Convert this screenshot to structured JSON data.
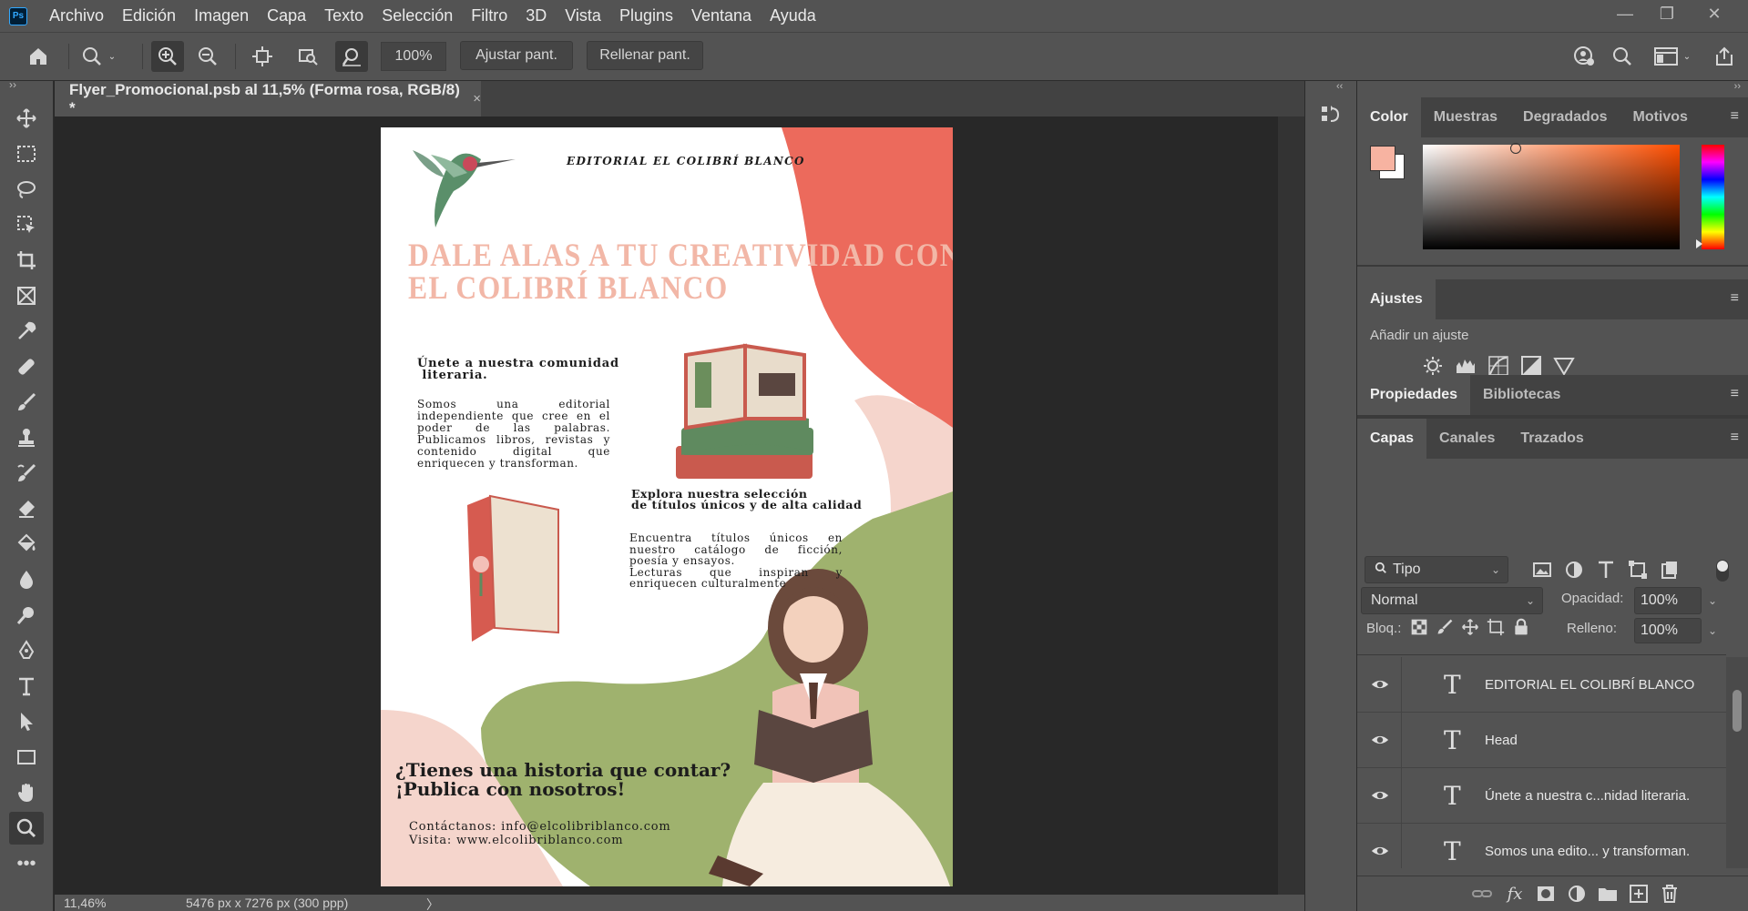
{
  "menubar": {
    "logo": "Ps",
    "items": [
      "Archivo",
      "Edición",
      "Imagen",
      "Capa",
      "Texto",
      "Selección",
      "Filtro",
      "3D",
      "Vista",
      "Plugins",
      "Ventana",
      "Ayuda"
    ]
  },
  "options": {
    "zoom_value": "100%",
    "fit_screen": "Ajustar pant.",
    "fill_screen": "Rellenar pant."
  },
  "document": {
    "tab_title": "Flyer_Promocional.psb al 11,5% (Forma rosa, RGB/8) *",
    "close": "×"
  },
  "status": {
    "zoom": "11,46%",
    "dims": "5476 px x 7276 px (300 ppp)",
    "arrow": "〉"
  },
  "flyer": {
    "publisher": "EDITORIAL EL COLIBRÍ  BLANCO",
    "headline": [
      "DALE ALAS A TU CREATIVIDAD CON",
      "EL COLIBRÍ BLANCO"
    ],
    "join_title": [
      "Únete a nuestra comunidad",
      " literaria."
    ],
    "about": [
      "Somos una editorial",
      "independiente que cree en el",
      "poder de las palabras.",
      "Publicamos libros, revistas y",
      "contenido digital que",
      "enriquecen y transforman."
    ],
    "explore_title": [
      "Explora nuestra selección",
      "de títulos únicos y de alta calidad"
    ],
    "explore_body": [
      "Encuentra títulos únicos en",
      "nuestro catálogo de ficción,",
      "poesía y ensayos.",
      "Lecturas que inspiran y",
      "enriquecen culturalmente"
    ],
    "cta": [
      "¿Tienes una historia que contar?",
      "¡Publica con nosotros!"
    ],
    "contact": "Contáctanos: info@elcolibriblanco.com",
    "visit": "Visita: www.elcolibriblanco.com"
  },
  "panels": {
    "color_tabs": [
      "Color",
      "Muestras",
      "Degradados",
      "Motivos"
    ],
    "adjust_tab": "Ajustes",
    "adjust_hint": "Añadir un ajuste",
    "props_tabs": [
      "Propiedades",
      "Bibliotecas"
    ],
    "layers_tabs": [
      "Capas",
      "Canales",
      "Trazados"
    ],
    "filter_label": "Tipo",
    "blend_mode": "Normal",
    "opacity_label": "Opacidad:",
    "opacity_value": "100%",
    "lock_label": "Bloq.:",
    "fill_label": "Relleno:",
    "fill_value": "100%",
    "menu_glyph": "≡",
    "collapse_left": "‹‹",
    "collapse_right": "››"
  },
  "layers": [
    {
      "name": "EDITORIAL EL COLIBRÍ  BLANCO"
    },
    {
      "name": "Head"
    },
    {
      "name": "Únete a nuestra c...nidad  literaria."
    },
    {
      "name": "Somos una edito... y transforman."
    }
  ],
  "colors": {
    "foreground": "#f7b3a1",
    "background": "#ffffff",
    "coral": "#ec6a5c",
    "pink": "#f5d5cc",
    "green": "#9fb26e",
    "headline": "#f2b7a7"
  }
}
